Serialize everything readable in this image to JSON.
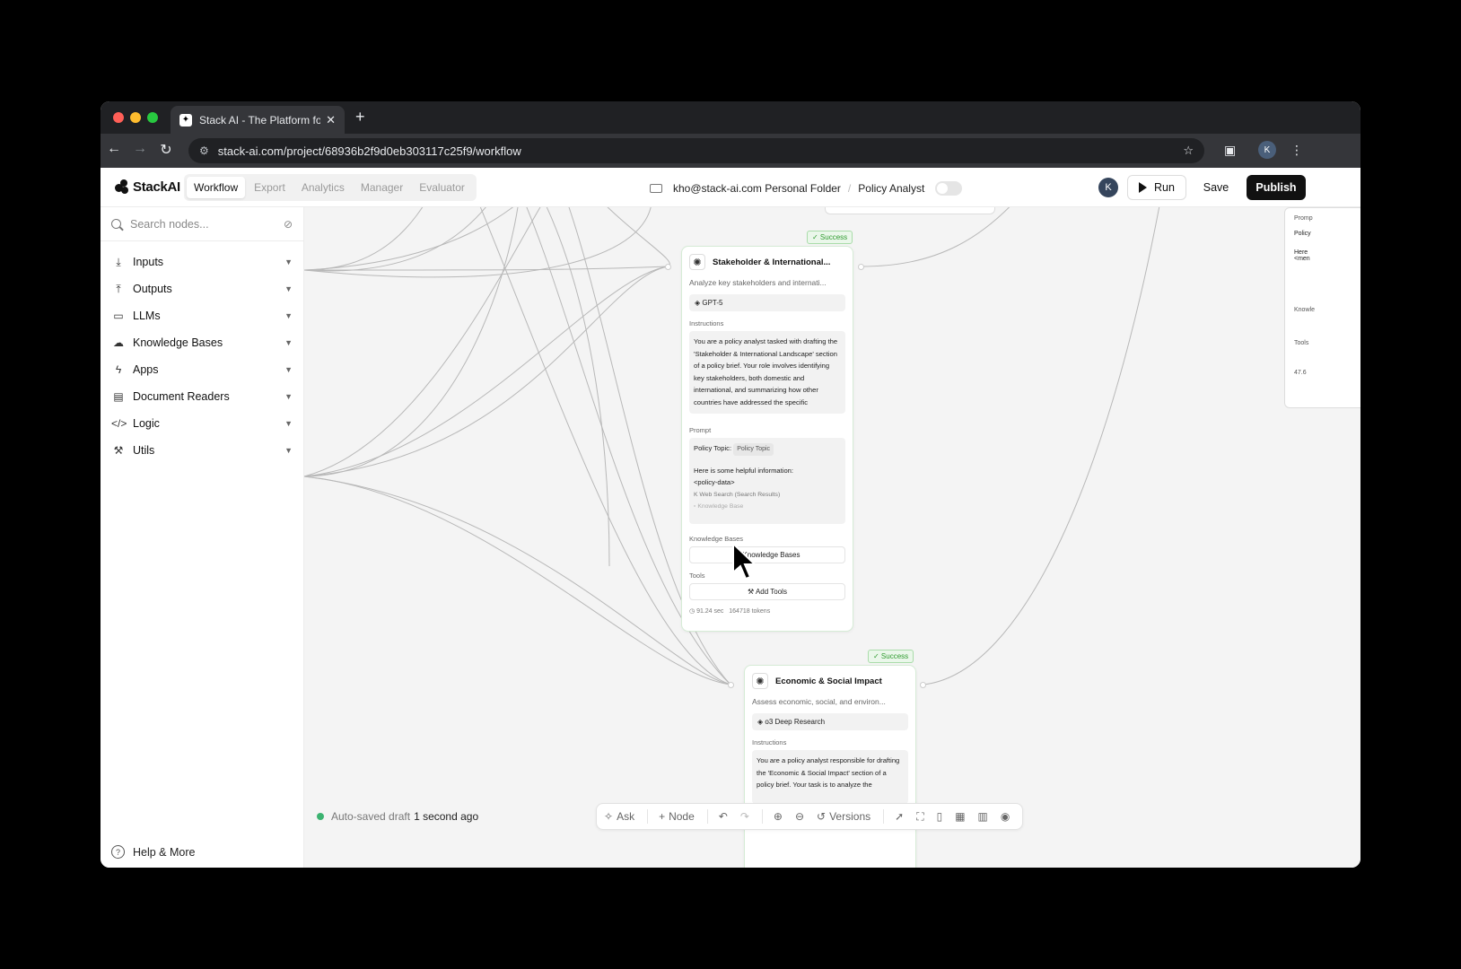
{
  "browser": {
    "tab_title": "Stack AI - The Platform for Enterprise AI",
    "new_tab_icon": "+",
    "url": "stack-ai.com/project/68936b2f9d0eb303117c25f9/workflow",
    "profile_initial": "K"
  },
  "header": {
    "logo_text": "StackAI",
    "tabs": [
      {
        "label": "Workflow"
      },
      {
        "label": "Export"
      },
      {
        "label": "Analytics"
      },
      {
        "label": "Manager"
      },
      {
        "label": "Evaluator"
      }
    ],
    "folder": "kho@stack-ai.com Personal Folder",
    "project": "Policy Analyst",
    "avatar_initial": "K",
    "run_label": "Run",
    "save_label": "Save",
    "publish_label": "Publish"
  },
  "sidebar": {
    "search_placeholder": "Search nodes...",
    "categories": [
      {
        "label": "Inputs",
        "icon": "download-icon"
      },
      {
        "label": "Outputs",
        "icon": "upload-icon"
      },
      {
        "label": "LLMs",
        "icon": "chat-icon"
      },
      {
        "label": "Knowledge Bases",
        "icon": "cloud-icon"
      },
      {
        "label": "Apps",
        "icon": "bolt-icon"
      },
      {
        "label": "Document Readers",
        "icon": "document-icon"
      },
      {
        "label": "Logic",
        "icon": "code-icon"
      },
      {
        "label": "Utils",
        "icon": "wrench-icon"
      }
    ],
    "help_label": "Help & More"
  },
  "canvas": {
    "node1": {
      "status": "✓ Success",
      "title": "Stakeholder & International...",
      "description": "Analyze key stakeholders and internati...",
      "model": "GPT-5",
      "instructions_label": "Instructions",
      "instructions": "You are a policy analyst tasked with drafting the 'Stakeholder & International Landscape' section of a policy brief. Your role involves identifying key stakeholders, both domestic and international, and summarizing how other countries have addressed the specific",
      "prompt_label": "Prompt",
      "prompt_topic_label": "Policy Topic:",
      "prompt_topic_chip": "Policy Topic",
      "prompt_line2": "Here is some helpful information:",
      "prompt_line3": "<policy-data>",
      "prompt_ref1": "Web Search (Search Results)",
      "prompt_ref2": "Knowledge Base",
      "kb_label": "Knowledge Bases",
      "kb_button": "Knowledge Bases",
      "tools_label": "Tools",
      "tools_button": "Add Tools",
      "time": "91.24 sec",
      "tokens": "164718 tokens"
    },
    "node2": {
      "status": "✓ Success",
      "title": "Economic & Social Impact",
      "description": "Assess economic, social, and environ...",
      "model": "o3 Deep Research",
      "instructions_label": "Instructions",
      "instructions": "You are a policy analyst responsible for drafting the 'Economic & Social Impact' section of a policy brief. Your task is to analyze the"
    },
    "partial": {
      "prompt_label": "Promp",
      "policy": "Policy",
      "here": "Here",
      "mem": "<men",
      "kb": "Knowle",
      "tools": "Tools",
      "stat": "47.6"
    },
    "autosave_text": "Auto-saved draft",
    "autosave_time": "1 second ago",
    "toolbar": {
      "ask": "Ask",
      "node": "Node",
      "versions": "Versions"
    }
  }
}
